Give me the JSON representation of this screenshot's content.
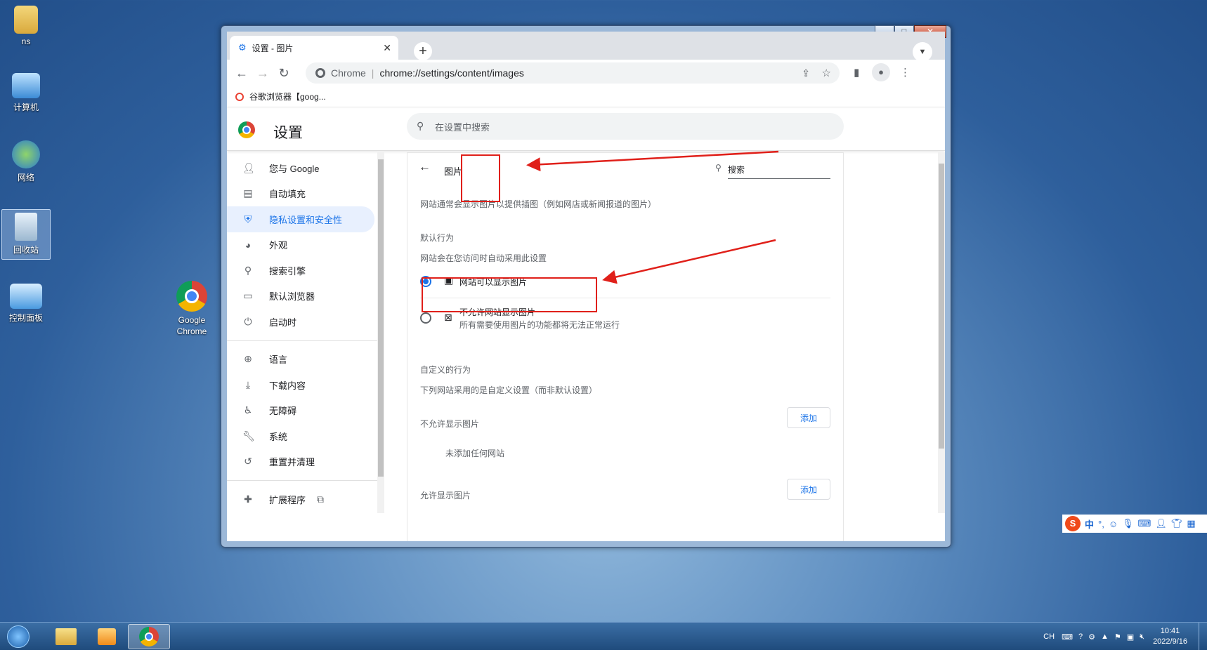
{
  "desktop": {
    "icons": [
      {
        "label": "ns"
      },
      {
        "label": "计算机"
      },
      {
        "label": "网络"
      },
      {
        "label": "回收站"
      },
      {
        "label": "控制面板"
      },
      {
        "label": "Google Chrome"
      }
    ]
  },
  "browser": {
    "tab": {
      "title": "设置 - 图片",
      "close": "✕"
    },
    "new_tab": "+",
    "address": {
      "host_label": "Chrome",
      "url": "chrome://settings/content/images"
    },
    "bookmark": "谷歌浏览器【goog..."
  },
  "settings": {
    "title": "设置",
    "search_placeholder": "在设置中搜索",
    "nav": [
      {
        "label": "您与 Google",
        "icon": "person-icon"
      },
      {
        "label": "自动填充",
        "icon": "clipboard-icon"
      },
      {
        "label": "隐私设置和安全性",
        "icon": "shield-icon"
      },
      {
        "label": "外观",
        "icon": "palette-icon"
      },
      {
        "label": "搜索引擎",
        "icon": "search-icon"
      },
      {
        "label": "默认浏览器",
        "icon": "browser-icon"
      },
      {
        "label": "启动时",
        "icon": "power-icon"
      },
      {
        "label": "语言",
        "icon": "globe-icon"
      },
      {
        "label": "下载内容",
        "icon": "download-icon"
      },
      {
        "label": "无障碍",
        "icon": "accessibility-icon"
      },
      {
        "label": "系统",
        "icon": "wrench-icon"
      },
      {
        "label": "重置并清理",
        "icon": "history-icon"
      },
      {
        "label": "扩展程序",
        "icon": "puzzle-icon"
      }
    ],
    "page": {
      "heading": "图片",
      "search_label": "搜索",
      "description": "网站通常会显示图片以提供插图（例如网店或新闻报道的图片）",
      "default_behavior": "默认行为",
      "default_behavior_desc": "网站会在您访问时自动采用此设置",
      "option_allow": "网站可以显示图片",
      "option_block": "不允许网站显示图片",
      "option_block_desc": "所有需要使用图片的功能都将无法正常运行",
      "custom_behavior": "自定义的行为",
      "custom_behavior_desc": "下列网站采用的是自定义设置（而非默认设置）",
      "not_allowed": "不允许显示图片",
      "add": "添加",
      "no_sites": "未添加任何网站",
      "allowed": "允许显示图片"
    }
  },
  "ime": {
    "label": "中"
  },
  "tray": {
    "lang": "CH",
    "time": "10:41",
    "date": "2022/9/16"
  },
  "colors": {
    "accent": "#1a73e8",
    "annotation": "#e0201a"
  }
}
